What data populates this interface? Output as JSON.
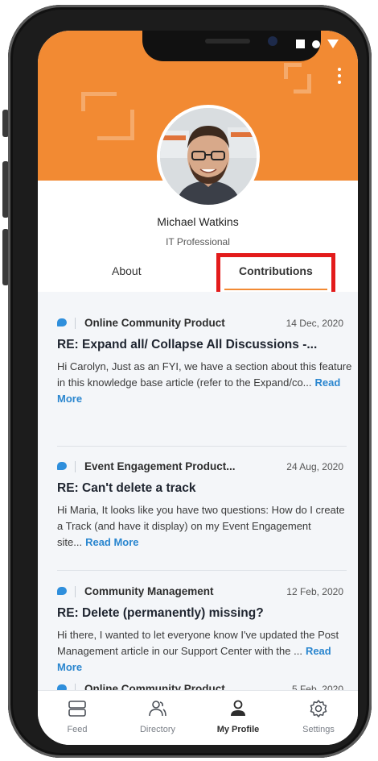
{
  "profile": {
    "name": "Michael Watkins",
    "title": "IT Professional"
  },
  "tabs": [
    {
      "label": "About",
      "active": false
    },
    {
      "label": "Contributions",
      "active": true
    }
  ],
  "posts": [
    {
      "category": "Online Community Product",
      "date": "14 Dec, 2020",
      "title": "RE: Expand all/ Collapse All Discussions -...",
      "body": "Hi Carolyn, Just as an FYI, we have a section about this feature in this knowledge base article (refer to the Expand/co...",
      "read_more": "Read More"
    },
    {
      "category": "Event Engagement Product...",
      "date": "24 Aug, 2020",
      "title": "RE: Can't delete a track",
      "body": "Hi Maria, It looks like you have two questions: How do I create a Track (and have it display) on my Event Engagement site...",
      "read_more": "Read More"
    },
    {
      "category": "Community Management",
      "date": "12 Feb, 2020",
      "title": "RE: Delete (permanently) missing?",
      "body": "Hi there, I wanted to let everyone know I've updated the Post Management  article in our Support Center with the ...",
      "read_more": "Read More"
    },
    {
      "category": "Online Community Product",
      "date": "5 Feb, 2020"
    }
  ],
  "nav": [
    {
      "label": "Feed",
      "icon": "feed-icon",
      "active": false
    },
    {
      "label": "Directory",
      "icon": "directory-icon",
      "active": false
    },
    {
      "label": "My Profile",
      "icon": "profile-icon",
      "active": true
    },
    {
      "label": "Settings",
      "icon": "settings-icon",
      "active": false
    }
  ],
  "colors": {
    "brand": "#f28a33",
    "link": "#2a86cf",
    "highlight": "#e31b1b",
    "list_bg": "#f4f6f9"
  }
}
